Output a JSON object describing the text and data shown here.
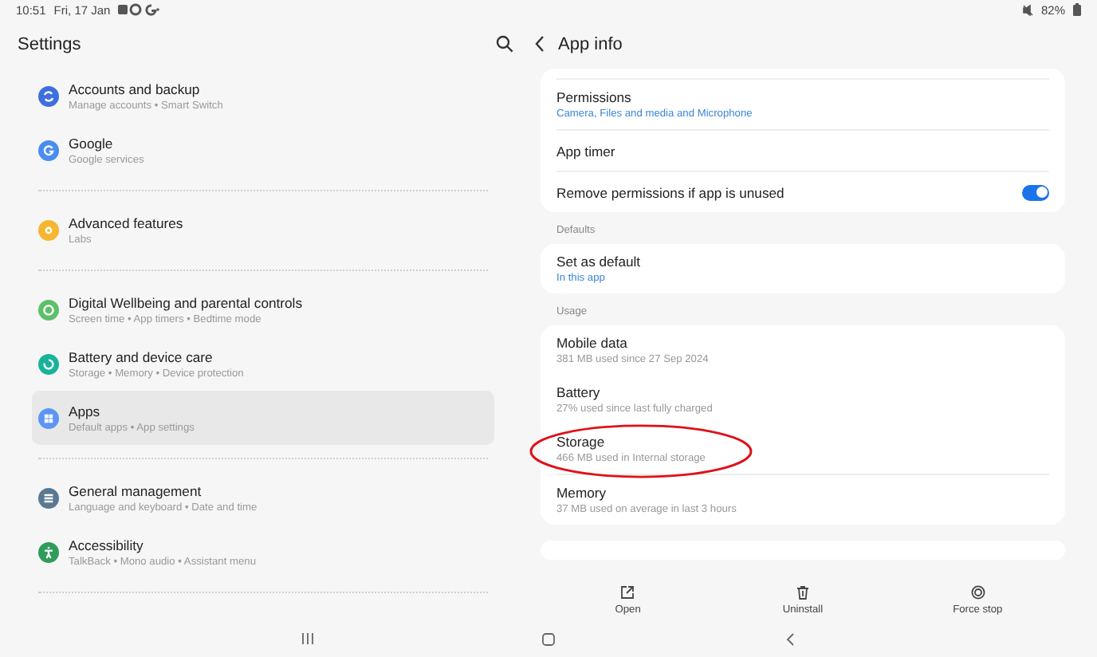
{
  "status_bar": {
    "time": "10:51",
    "date": "Fri, 17 Jan",
    "battery": "82%"
  },
  "settings": {
    "title": "Settings",
    "groups": [
      {
        "items": [
          {
            "title": "Accounts and backup",
            "subtitle": "Manage accounts • Smart Switch",
            "selected": false,
            "color": "#3e6fe0"
          },
          {
            "title": "Google",
            "subtitle": "Google services",
            "selected": false,
            "color": "#4a8df0"
          }
        ]
      },
      {
        "items": [
          {
            "title": "Advanced features",
            "subtitle": "Labs",
            "selected": false,
            "color": "#f5b731"
          }
        ]
      },
      {
        "items": [
          {
            "title": "Digital Wellbeing and parental controls",
            "subtitle": "Screen time • App timers • Bedtime mode",
            "selected": false,
            "color": "#5cc06a"
          },
          {
            "title": "Battery and device care",
            "subtitle": "Storage • Memory • Device protection",
            "selected": false,
            "color": "#18b39a"
          },
          {
            "title": "Apps",
            "subtitle": "Default apps • App settings",
            "selected": true,
            "color": "#5d95f4"
          }
        ]
      },
      {
        "items": [
          {
            "title": "General management",
            "subtitle": "Language and keyboard • Date and time",
            "selected": false,
            "color": "#5a7891"
          },
          {
            "title": "Accessibility",
            "subtitle": "TalkBack • Mono audio • Assistant menu",
            "selected": false,
            "color": "#2f9d5a"
          }
        ]
      }
    ]
  },
  "app_info": {
    "title": "App info",
    "sections": [
      {
        "rows": [
          {
            "kind": "link",
            "title": "Permissions",
            "subtitle": "Camera, Files and media and Microphone"
          },
          {
            "kind": "plain",
            "title": "App timer"
          },
          {
            "kind": "toggle",
            "title": "Remove permissions if app is unused",
            "on": true
          }
        ]
      },
      {
        "label": "Defaults",
        "rows": [
          {
            "kind": "link",
            "title": "Set as default",
            "subtitle": "In this app"
          }
        ]
      },
      {
        "label": "Usage",
        "rows": [
          {
            "kind": "info",
            "title": "Mobile data",
            "subtitle": "381 MB used since 27 Sep 2024"
          },
          {
            "kind": "info",
            "title": "Battery",
            "subtitle": "27% used since last fully charged"
          },
          {
            "kind": "info",
            "title": "Storage",
            "subtitle": "466 MB used in Internal storage",
            "circled": true
          },
          {
            "kind": "info",
            "title": "Memory",
            "subtitle": "37 MB used on average in last 3 hours"
          }
        ]
      }
    ],
    "actions": [
      "Open",
      "Uninstall",
      "Force stop"
    ]
  }
}
